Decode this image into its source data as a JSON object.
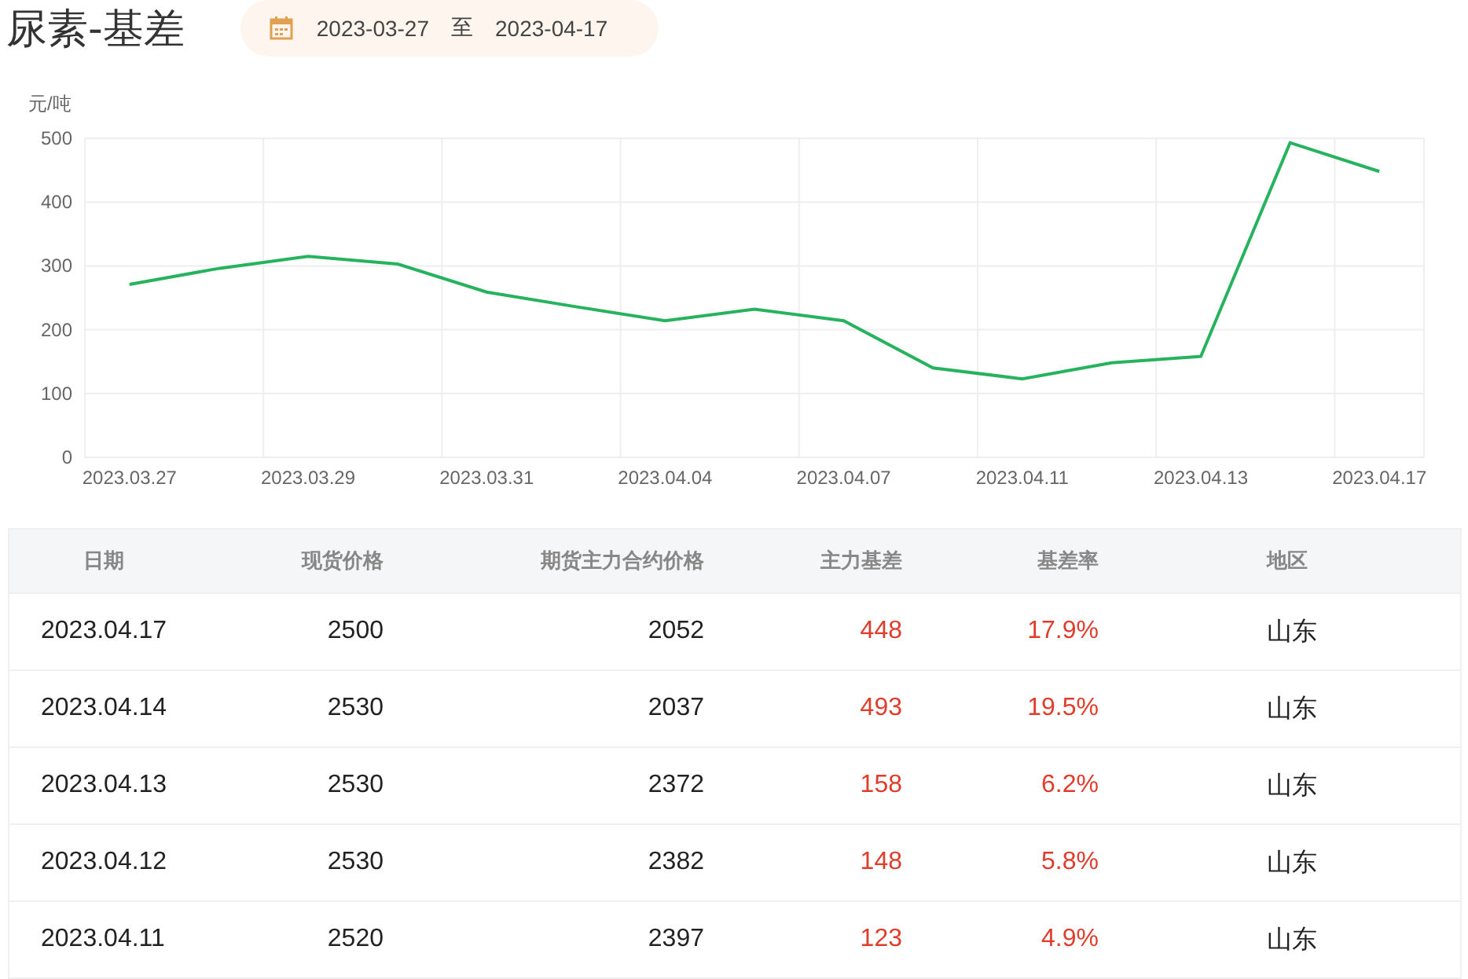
{
  "title": "尿素-基差",
  "date_range": {
    "start": "2023-03-27",
    "separator": "至",
    "end": "2023-04-17"
  },
  "chart_data": {
    "type": "line",
    "ylabel": "元/吨",
    "categories": [
      "2023.03.27",
      null,
      "2023.03.29",
      null,
      "2023.03.31",
      null,
      "2023.04.04",
      null,
      "2023.04.07",
      null,
      "2023.04.11",
      null,
      "2023.04.13",
      null,
      "2023.04.17"
    ],
    "ylim": [
      0,
      500
    ],
    "yticks": [
      0,
      100,
      200,
      300,
      400,
      500
    ],
    "grid": true,
    "series": [
      {
        "color": "#27b35e",
        "values": [
          271,
          296,
          315,
          303,
          259,
          236,
          214,
          232,
          214,
          140,
          123,
          148,
          158,
          493,
          448
        ]
      }
    ]
  },
  "table": {
    "columns": [
      "日期",
      "现货价格",
      "期货主力合约价格",
      "主力基差",
      "基差率",
      "地区"
    ],
    "rows": [
      [
        "2023.04.17",
        "2500",
        "2052",
        "448",
        "17.9%",
        "山东"
      ],
      [
        "2023.04.14",
        "2530",
        "2037",
        "493",
        "19.5%",
        "山东"
      ],
      [
        "2023.04.13",
        "2530",
        "2372",
        "158",
        "6.2%",
        "山东"
      ],
      [
        "2023.04.12",
        "2530",
        "2382",
        "148",
        "5.8%",
        "山东"
      ],
      [
        "2023.04.11",
        "2520",
        "2397",
        "123",
        "4.9%",
        "山东"
      ]
    ]
  }
}
